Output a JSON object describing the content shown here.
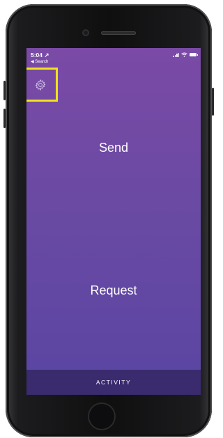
{
  "status_bar": {
    "time": "5:04 ↗",
    "back_label": "◀ Search"
  },
  "icons": {
    "settings": "gear-icon",
    "signal": "signal-bars-icon",
    "wifi": "wifi-icon",
    "battery": "battery-icon"
  },
  "main": {
    "send_label": "Send",
    "request_label": "Request"
  },
  "bottom_bar": {
    "activity_label": "ACTIVITY"
  },
  "colors": {
    "highlight": "#f3e21b",
    "gradient_top": "#7a4aa6",
    "gradient_bottom": "#5a45a3",
    "activity_bar": "#3a2a6e"
  }
}
